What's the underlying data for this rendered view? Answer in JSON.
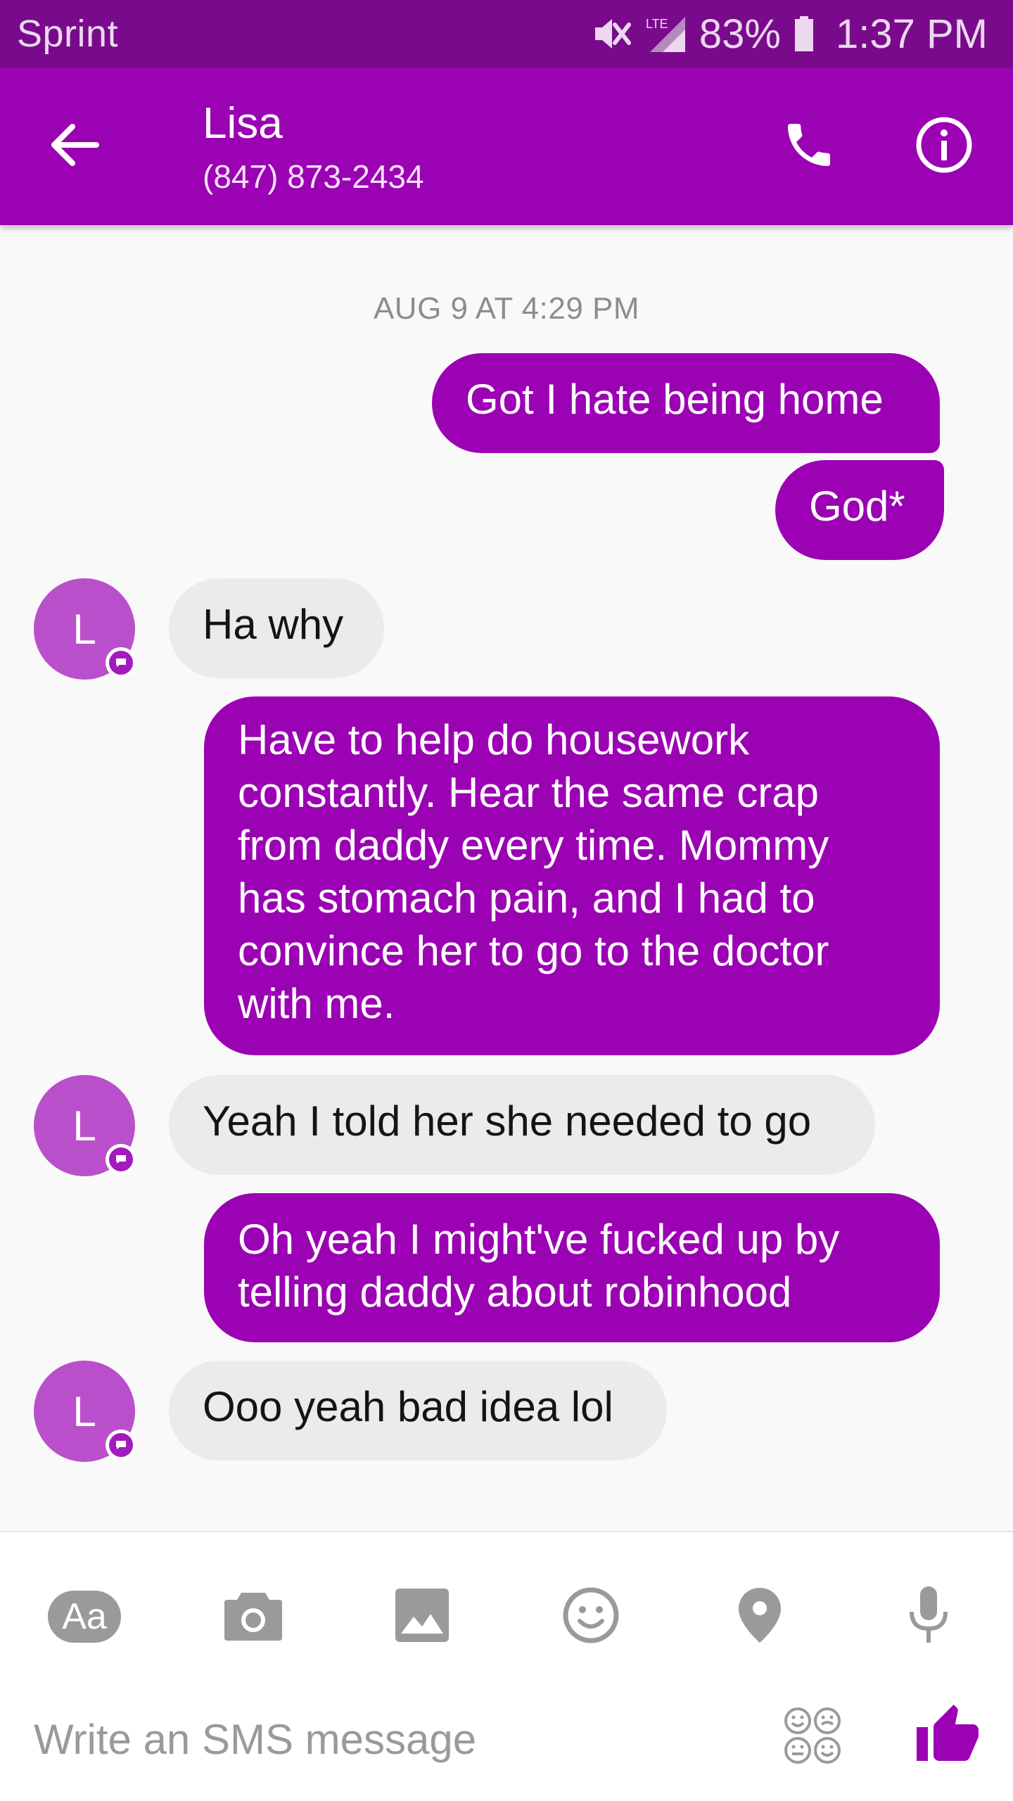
{
  "status_bar": {
    "carrier": "Sprint",
    "network": "LTE",
    "battery": "83%",
    "time": "1:37 PM"
  },
  "header": {
    "contact_name": "Lisa",
    "contact_number": "(847) 873-2434",
    "back_icon": "arrow-back-icon",
    "call_icon": "phone-icon",
    "info_icon": "info-icon"
  },
  "thread": {
    "timestamp": "AUG 9 AT 4:29 PM",
    "avatar_initial": "L",
    "messages": [
      {
        "direction": "outgoing",
        "text": "Got I hate being home"
      },
      {
        "direction": "outgoing",
        "text": "God*"
      },
      {
        "direction": "incoming",
        "text": "Ha why"
      },
      {
        "direction": "outgoing",
        "text": "Have to help do housework\nconstantly. Hear the same crap\nfrom daddy every time. Mommy\nhas stomach pain, and I had to\nconvince her to go to the doctor\nwith me."
      },
      {
        "direction": "incoming",
        "text": "Yeah I told her she needed to go"
      },
      {
        "direction": "outgoing",
        "text": "Oh yeah I might've fucked up by\ntelling daddy about robinhood"
      },
      {
        "direction": "incoming",
        "text": "Ooo yeah bad idea lol"
      }
    ]
  },
  "composer": {
    "text_tool_label": "Aa",
    "tools": [
      "text-format-icon",
      "camera-icon",
      "image-icon",
      "emoji-icon",
      "location-icon",
      "microphone-icon"
    ],
    "placeholder": "Write an SMS message",
    "sticker_icon": "sticker-icon",
    "send_icon": "thumbs-up-icon"
  },
  "colors": {
    "status_bar": "#7a0a8c",
    "brand": "#9b02b3",
    "avatar": "#ba4fcb",
    "incoming_bubble": "#ebebeb"
  }
}
